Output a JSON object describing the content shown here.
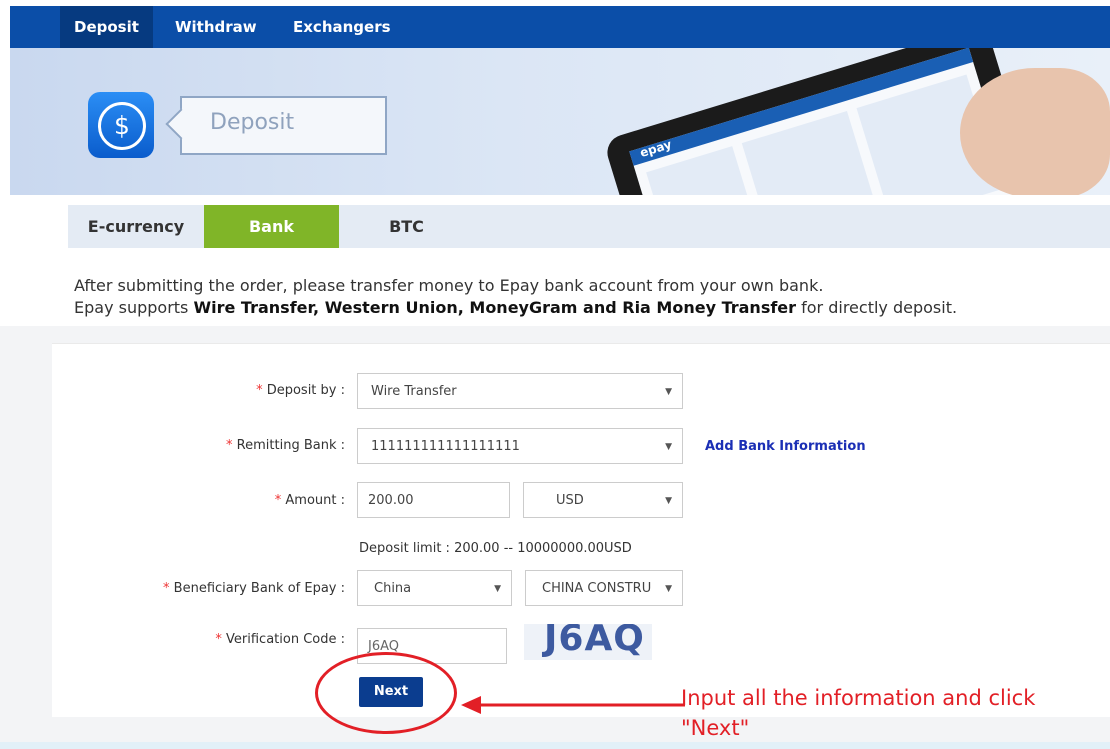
{
  "nav": {
    "items": [
      {
        "label": "Deposit",
        "active": true
      },
      {
        "label": "Withdraw",
        "active": false
      },
      {
        "label": "Exchangers",
        "active": false
      }
    ]
  },
  "banner": {
    "title": "Deposit",
    "icon": "dollar-circle-icon",
    "tablet_logo": "epay"
  },
  "tabs": [
    {
      "label": "E-currency",
      "active": false
    },
    {
      "label": "Bank",
      "active": true
    },
    {
      "label": "BTC",
      "active": false
    }
  ],
  "intro": {
    "line1": "After submitting the order, please transfer money to Epay bank account from your own bank.",
    "line2_prefix": "Epay supports ",
    "line2_bold": "Wire Transfer, Western Union, MoneyGram and Ria Money Transfer",
    "line2_suffix": " for directly deposit."
  },
  "form": {
    "required_mark": "*",
    "deposit_by": {
      "label": "Deposit by :",
      "value": "Wire Transfer"
    },
    "remitting_bank": {
      "label": "Remitting Bank :",
      "value": "111111111111111111",
      "link": "Add Bank Information"
    },
    "amount": {
      "label": "Amount :",
      "value": "200.00",
      "currency": "USD"
    },
    "deposit_limit": "Deposit limit : 200.00 -- 10000000.00USD",
    "beneficiary": {
      "label": "Beneficiary Bank of Epay :",
      "country": "China",
      "bank": "CHINA CONSTRU"
    },
    "verification": {
      "label": "Verification Code :",
      "value": "J6AQ",
      "captcha_text": "J6AQ"
    },
    "next_label": "Next"
  },
  "annotation": {
    "text": "Input all the information and click \"Next\"",
    "color": "#e21f26"
  },
  "colors": {
    "nav_bg": "#0b4ea8",
    "tab_active": "#80b528",
    "button": "#0b3d8f",
    "link": "#1b2fb5",
    "required": "#ee3333"
  }
}
